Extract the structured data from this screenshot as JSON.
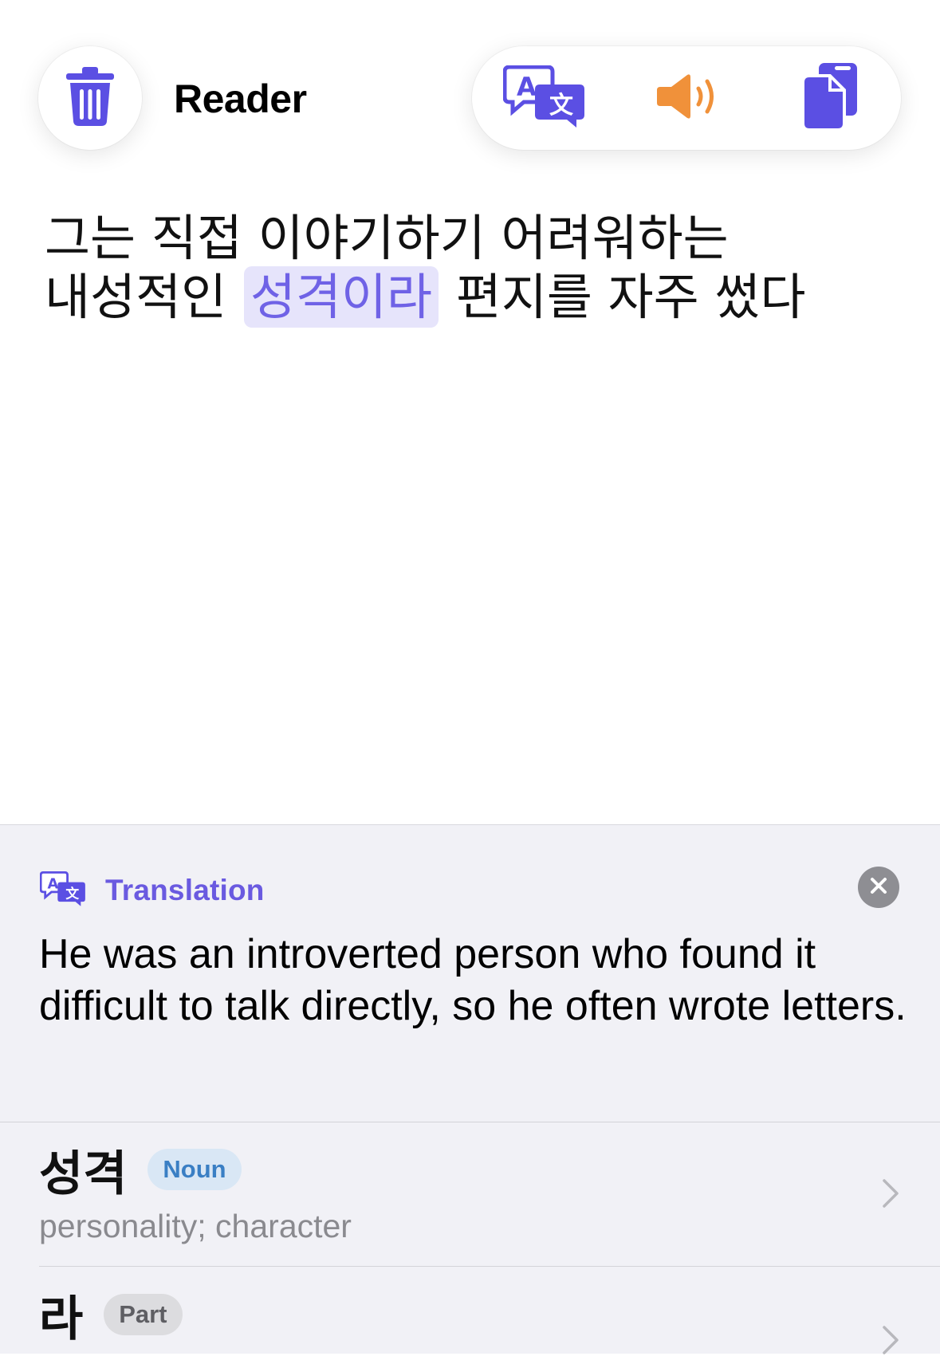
{
  "header": {
    "title": "Reader",
    "icons": {
      "delete": "trash-icon",
      "translate": "translate-icon",
      "speak": "speaker-icon",
      "copy": "copy-icon"
    },
    "colors": {
      "accent": "#5b4fe3",
      "speaker": "#f0913a"
    }
  },
  "reader": {
    "line1": "그는 직접 이야기하기 어려워하는",
    "line2_before": "내성적인",
    "line2_highlight": "성격이라",
    "line2_after": "편지를 자주 썼다"
  },
  "translation": {
    "label": "Translation",
    "text": "He was an introverted person who found it difficult to talk directly, so he often wrote letters.",
    "close_icon": "close-icon"
  },
  "words": [
    {
      "word": "성격",
      "tag": "Noun",
      "gloss": "personality; character"
    },
    {
      "word": "라",
      "tag": "Part",
      "gloss": ""
    }
  ]
}
